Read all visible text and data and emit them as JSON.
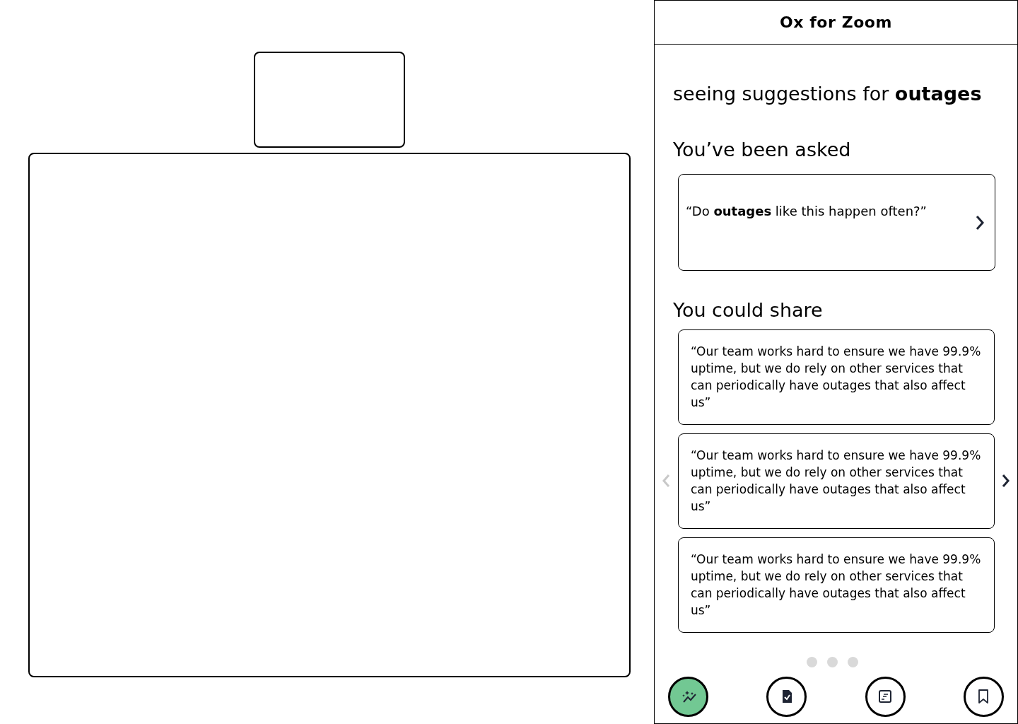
{
  "panel": {
    "title": "Ox for Zoom"
  },
  "topic_line": "seeing suggestions for **outages**",
  "asked": {
    "heading": "You’ve been asked",
    "questions": [
      {
        "text": "“Do **outages** like this happen often?”"
      }
    ]
  },
  "share": {
    "heading": "You could share",
    "prev_disabled": true,
    "next_disabled": false,
    "suggestions": [
      {
        "text": "“Our team works hard to ensure we have 99.9% uptime, but we do rely on other services that can periodically have outages that also affect us”"
      },
      {
        "text": "“Our team works hard to ensure we have 99.9% uptime, but we do rely on other services that can periodically have outages that also affect us”"
      },
      {
        "text": "“Our team works hard to ensure we have 99.9% uptime, but we do rely on other services that can periodically have outages that also affect us”"
      }
    ],
    "page_dots": [
      {
        "selected": false
      },
      {
        "selected": false
      },
      {
        "selected": false
      }
    ]
  },
  "nav": [
    {
      "kind": "suggestions",
      "selected": true
    },
    {
      "kind": "checklist",
      "selected": false
    },
    {
      "kind": "notes",
      "selected": false
    },
    {
      "kind": "bookmarks",
      "selected": false
    }
  ]
}
